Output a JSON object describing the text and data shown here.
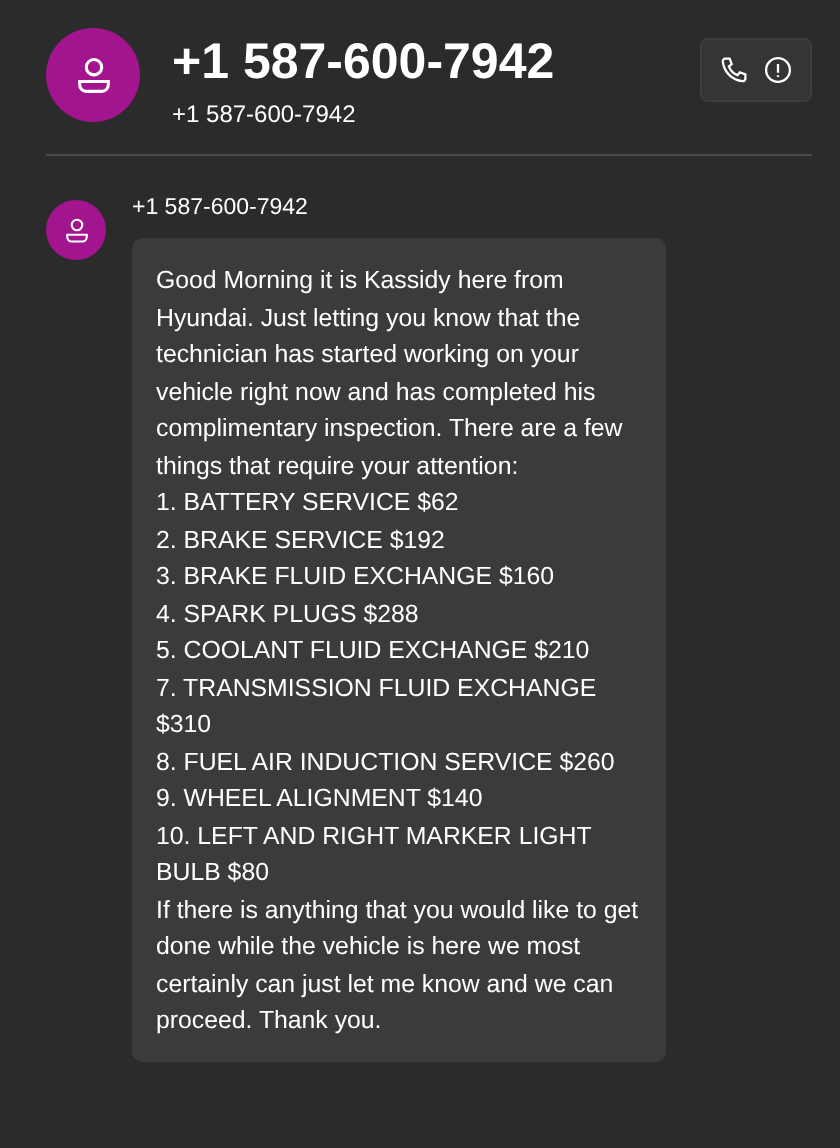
{
  "header": {
    "title": "+1 587-600-7942",
    "subtitle": "+1 587-600-7942"
  },
  "messages": [
    {
      "sender": "+1 587-600-7942",
      "intro": "Good Morning it is Kassidy here from Hyundai. Just letting you know that the technician has started working on your vehicle right now and has completed his complimentary inspection. There are a few things that require your attention:",
      "items": [
        "1. BATTERY SERVICE $62",
        "2. BRAKE SERVICE $192",
        "3. BRAKE FLUID EXCHANGE $160",
        "4. SPARK PLUGS $288",
        "5. COOLANT FLUID EXCHANGE $210",
        "7. TRANSMISSION FLUID EXCHANGE $310",
        "8. FUEL AIR INDUCTION SERVICE $260",
        "9. WHEEL ALIGNMENT $140",
        "10. LEFT AND RIGHT MARKER LIGHT BULB $80"
      ],
      "closing": "If there is anything that you would like to get done while the vehicle is here we most certainly can just let me know and we can proceed. Thank you."
    }
  ]
}
